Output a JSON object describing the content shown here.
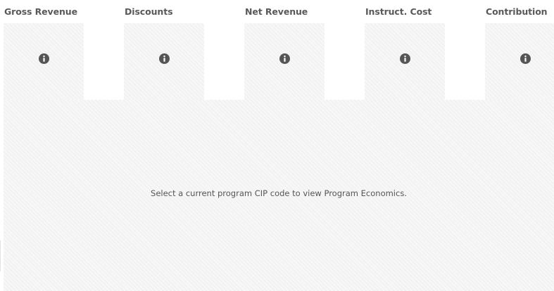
{
  "kpis": [
    {
      "title": "Gross Revenue",
      "info_icon": "info-circle-icon"
    },
    {
      "title": "Discounts",
      "info_icon": "info-circle-icon"
    },
    {
      "title": "Net Revenue",
      "info_icon": "info-circle-icon"
    },
    {
      "title": "Instruct. Cost",
      "info_icon": "info-circle-icon"
    },
    {
      "title": "Contribution",
      "info_icon": "info-circle-icon"
    }
  ],
  "empty_state": {
    "message": "Select a current program CIP code to view Program Economics."
  },
  "colors": {
    "title_text": "#595959",
    "icon": "#555555",
    "panel_bg": "#f7f7f7",
    "message_text": "#555555"
  }
}
